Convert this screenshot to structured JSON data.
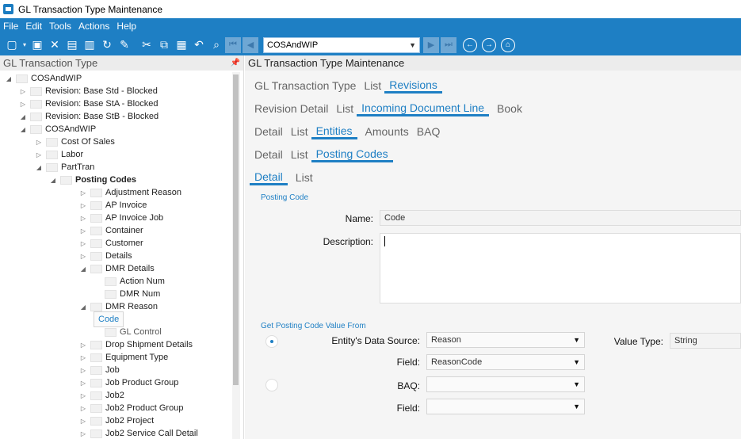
{
  "window": {
    "title": "GL Transaction Type Maintenance"
  },
  "menu": [
    "File",
    "Edit",
    "Tools",
    "Actions",
    "Help"
  ],
  "toolbar": {
    "combo_value": "COSAndWIP"
  },
  "left": {
    "header": "GL Transaction Type",
    "tree": [
      {
        "label": "COSAndWIP",
        "level": 0,
        "exp": "open"
      },
      {
        "label": "Revision: Base Std - Blocked",
        "level": 1,
        "exp": "closed"
      },
      {
        "label": "Revision: Base StA - Blocked",
        "level": 1,
        "exp": "closed"
      },
      {
        "label": "Revision: Base StB - Blocked",
        "level": 1,
        "exp": "open"
      },
      {
        "label": "COSAndWIP",
        "level": 2,
        "exp": "open"
      },
      {
        "label": "Cost Of Sales",
        "level": 3,
        "exp": "closed"
      },
      {
        "label": "Labor",
        "level": 3,
        "exp": "closed"
      },
      {
        "label": "PartTran",
        "level": 3,
        "exp": "open"
      },
      {
        "label": "Posting Codes",
        "level": 4,
        "exp": "open",
        "style": "bold"
      },
      {
        "label": "Adjustment Reason",
        "level": 5,
        "exp": "closed"
      },
      {
        "label": "AP Invoice",
        "level": 5,
        "exp": "closed"
      },
      {
        "label": "AP Invoice Job",
        "level": 5,
        "exp": "closed"
      },
      {
        "label": "Container",
        "level": 5,
        "exp": "closed"
      },
      {
        "label": "Customer",
        "level": 5,
        "exp": "closed"
      },
      {
        "label": "Details",
        "level": 5,
        "exp": "closed"
      },
      {
        "label": "DMR Details",
        "level": 5,
        "exp": "open"
      },
      {
        "label": "Action Num",
        "level": 6,
        "exp": "none"
      },
      {
        "label": "DMR Num",
        "level": 6,
        "exp": "none"
      },
      {
        "label": "DMR Reason",
        "level": 5,
        "exp": "open"
      },
      {
        "label": "Code",
        "level": 6,
        "exp": "none",
        "style": "sel"
      },
      {
        "label": "GL Control",
        "level": 6,
        "exp": "none",
        "style": "gray"
      },
      {
        "label": "Drop Shipment Details",
        "level": 5,
        "exp": "closed"
      },
      {
        "label": "Equipment Type",
        "level": 5,
        "exp": "closed"
      },
      {
        "label": "Job",
        "level": 5,
        "exp": "closed"
      },
      {
        "label": "Job Product Group",
        "level": 5,
        "exp": "closed"
      },
      {
        "label": "Job2",
        "level": 5,
        "exp": "closed"
      },
      {
        "label": "Job2 Product Group",
        "level": 5,
        "exp": "closed"
      },
      {
        "label": "Job2 Project",
        "level": 5,
        "exp": "closed"
      },
      {
        "label": "Job2 Service Call Detail",
        "level": 5,
        "exp": "closed"
      }
    ]
  },
  "right": {
    "header": "GL Transaction Type Maintenance",
    "tabrows": [
      {
        "tabs": [
          "GL Transaction Type",
          "List",
          "Revisions"
        ],
        "active": 2
      },
      {
        "tabs": [
          "Revision Detail",
          "List",
          "Incoming Document Line",
          "Book"
        ],
        "active": 2
      },
      {
        "tabs": [
          "Detail",
          "List",
          "Entities",
          "Amounts",
          "BAQ"
        ],
        "active": 2
      },
      {
        "tabs": [
          "Detail",
          "List",
          "Posting Codes"
        ],
        "active": 2
      },
      {
        "tabs": [
          "Detail",
          "List"
        ],
        "active": 0
      }
    ],
    "posting_code_section": "Posting Code",
    "name_label": "Name:",
    "name_value": "Code",
    "description_label": "Description:",
    "description_value": "",
    "value_from_section": "Get Posting Code Value From",
    "entity_source_label": "Entity's Data Source:",
    "entity_source_value": "Reason",
    "field1_label": "Field:",
    "field1_value": "ReasonCode",
    "baq_label": "BAQ:",
    "baq_value": "",
    "field2_label": "Field:",
    "field2_value": "",
    "value_type_label": "Value Type:",
    "value_type_value": "String"
  }
}
